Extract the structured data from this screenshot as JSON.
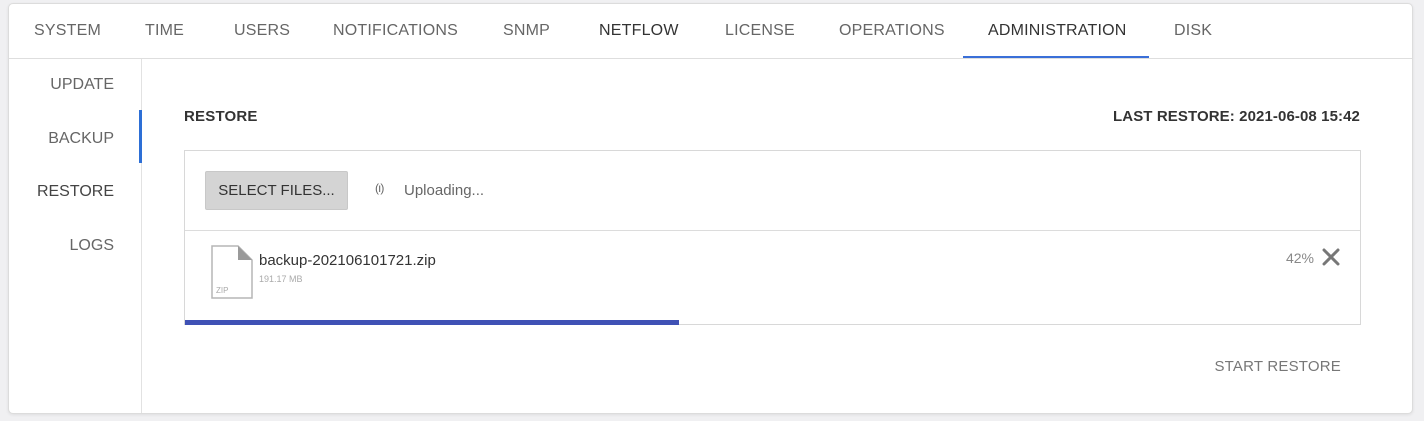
{
  "tabs": [
    {
      "label": "SYSTEM"
    },
    {
      "label": "TIME"
    },
    {
      "label": "USERS"
    },
    {
      "label": "NOTIFICATIONS"
    },
    {
      "label": "SNMP"
    },
    {
      "label": "NETFLOW"
    },
    {
      "label": "LICENSE"
    },
    {
      "label": "OPERATIONS"
    },
    {
      "label": "ADMINISTRATION",
      "active": true
    },
    {
      "label": "DISK"
    }
  ],
  "sidebar": {
    "items": [
      {
        "label": "UPDATE"
      },
      {
        "label": "BACKUP"
      },
      {
        "label": "RESTORE",
        "active": true
      },
      {
        "label": "LOGS"
      }
    ]
  },
  "restore": {
    "title": "RESTORE",
    "last_restore": "LAST RESTORE: 2021-06-08 15:42",
    "select_button": "SELECT FILES...",
    "status_icon": "(ı)",
    "status_text": "Uploading...",
    "file": {
      "icon_label": "ZIP",
      "name": "backup-202106101721.zip",
      "size": "191.17 MB",
      "progress_label": "42%",
      "progress_fraction": 0.42
    },
    "start_button": "START RESTORE"
  },
  "colors": {
    "accent": "#3a6fd8",
    "progress": "#3f51b5",
    "button_bg": "#d4d4d4"
  },
  "icons": {
    "remove": "close-icon",
    "file": "zip-file-icon",
    "status": "uploading-spinner-icon"
  }
}
